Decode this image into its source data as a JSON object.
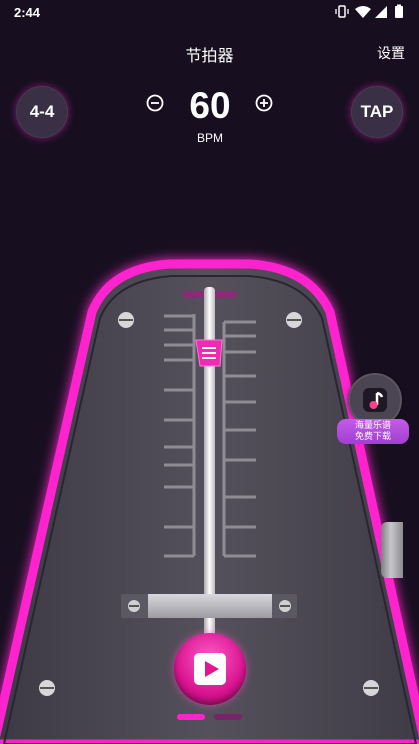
{
  "status_bar": {
    "time": "2:44"
  },
  "header": {
    "title": "节拍器",
    "settings_label": "设置"
  },
  "controls": {
    "time_signature": "4-4",
    "bpm": "60",
    "bpm_unit": "BPM",
    "tap_label": "TAP"
  },
  "promo": {
    "line1": "海量乐谱",
    "line2": "免费下载"
  },
  "colors": {
    "accent": "#ff1fc8",
    "background": "#170f1f",
    "body": "#4e4a56"
  },
  "tempo": {
    "beats_indicator_active": 0
  }
}
